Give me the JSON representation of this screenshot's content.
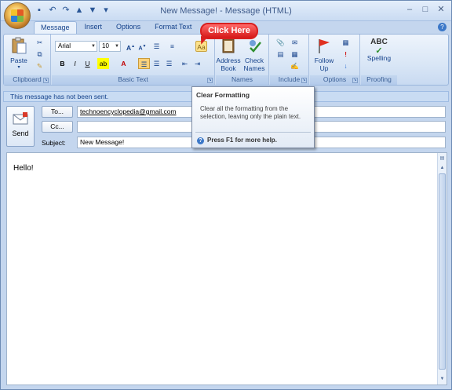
{
  "window": {
    "title": "New Message! - Message (HTML)",
    "controls": [
      "–",
      "□",
      "✕"
    ]
  },
  "qat": [
    "save-icon",
    "undo-icon",
    "redo-icon",
    "up-arrow-icon",
    "down-arrow-icon"
  ],
  "tabs": [
    {
      "label": "Message",
      "active": true
    },
    {
      "label": "Insert",
      "active": false
    },
    {
      "label": "Options",
      "active": false
    },
    {
      "label": "Format Text",
      "active": false
    }
  ],
  "ribbon": {
    "clipboard": {
      "label": "Clipboard",
      "paste": "Paste"
    },
    "basic_text": {
      "label": "Basic Text",
      "font": "Arial",
      "size": "10",
      "bold": "B",
      "italic": "I",
      "underline": "U"
    },
    "names": {
      "label": "Names",
      "address_book": "Address Book",
      "check_names": "Check Names"
    },
    "include": {
      "label": "Include"
    },
    "options": {
      "label": "Options",
      "follow_up": "Follow Up"
    },
    "proofing": {
      "label": "Proofing",
      "spelling": "Spelling",
      "abc": "ABC"
    }
  },
  "callout": {
    "text": "Click Here"
  },
  "tooltip": {
    "title": "Clear Formatting",
    "body": "Clear all the formatting from the selection, leaving only the plain text.",
    "help": "Press F1 for more help."
  },
  "message_bar": "This message has not been sent.",
  "header": {
    "send": "Send",
    "to_label": "To...",
    "to_value": "technoencyclopedia@gmail.com",
    "cc_label": "Cc...",
    "cc_value": "",
    "subject_label": "Subject:",
    "subject_value": "New Message!"
  },
  "body": {
    "text": "Hello!"
  },
  "colors": {
    "accent": "#15428b",
    "callout": "#d82020",
    "ribbon_bg": "#d9e6f6"
  }
}
